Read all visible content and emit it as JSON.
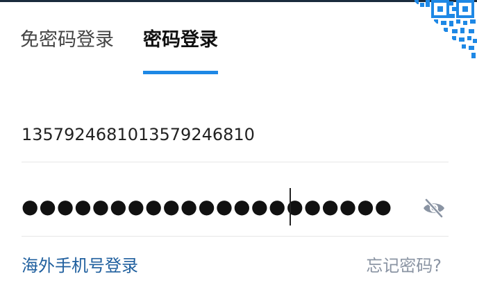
{
  "tabs": [
    {
      "label": "免密码登录",
      "active": false
    },
    {
      "label": "密码登录",
      "active": true
    }
  ],
  "phone": {
    "value": "13579246810135792468​10"
  },
  "password": {
    "masked": "●●●●●●●●●●●●●●●●●●●●●"
  },
  "links": {
    "overseas_login": "海外手机号登录",
    "forgot_password": "忘记密码?"
  },
  "colors": {
    "accent": "#1e88e5",
    "link_blue": "#1f5f9e",
    "muted": "#8a94a3"
  },
  "icons": {
    "qr": "qr-code-icon",
    "eye": "eye-slash-icon"
  }
}
